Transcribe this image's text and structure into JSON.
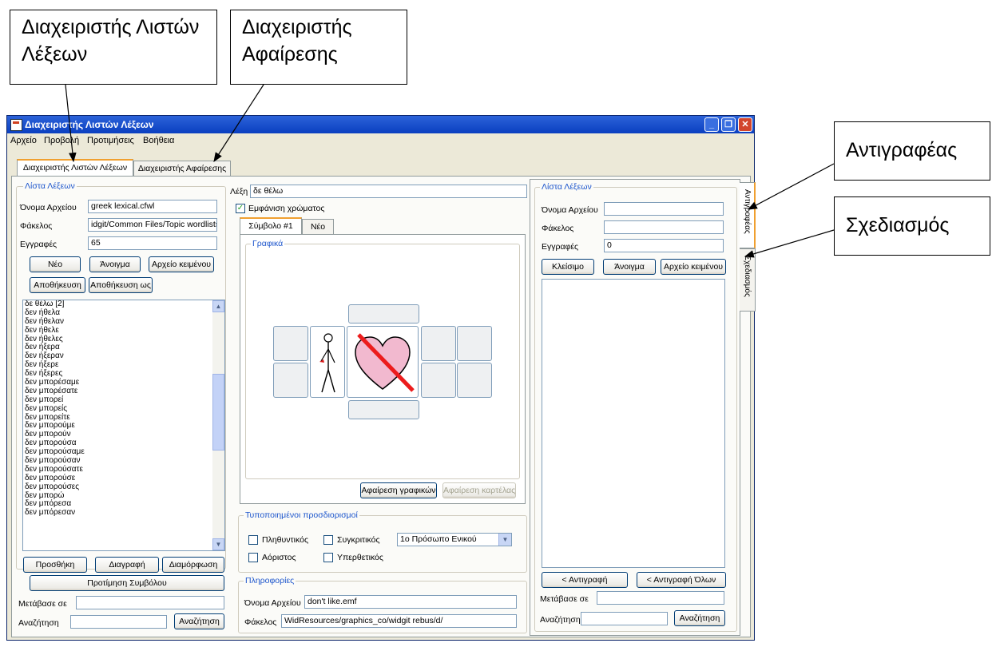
{
  "callouts": {
    "wordlist_manager": "Διαχειριστής Λιστών Λέξεων",
    "removal_manager": "Διαχειριστής Αφαίρεσης",
    "copier": "Αντιγραφέας",
    "design": "Σχεδιασμός"
  },
  "window": {
    "title": "Διαχειριστής Λιστών Λέξεων",
    "menu": [
      "Αρχείο",
      "Προβολή",
      "Προτιμήσεις",
      "Βοήθεια"
    ],
    "tabs": [
      "Διαχειριστής Λιστών Λέξεων",
      "Διαχειριστής Αφαίρεσης"
    ]
  },
  "left": {
    "group_label": "Λίστα Λέξεων",
    "filename_label": "Όνομα Αρχείου",
    "filename_value": "greek lexical.cfwl",
    "folder_label": "Φάκελος",
    "folder_value": "idgit/Common Files/Topic wordlists/",
    "entries_label": "Εγγραφές",
    "entries_value": "65",
    "buttons": {
      "new": "Νέο",
      "open": "Άνοιγμα",
      "textfile": "Αρχείο κειμένου",
      "save": "Αποθήκευση",
      "saveas": "Αποθήκευση ως"
    },
    "words": [
      "δε θέλω [2]",
      "δεν ήθελα",
      "δεν ήθελαν",
      "δεν ήθελε",
      "δεν ήθελες",
      "δεν ήξερα",
      "δεν ήξεραν",
      "δεν ήξερε",
      "δεν ήξερες",
      "δεν μπορέσαμε",
      "δεν μπορέσατε",
      "δεν μπορεί",
      "δεν μπορείς",
      "δεν μπορείτε",
      "δεν μπορούμε",
      "δεν μπορούν",
      "δεν μπορούσα",
      "δεν μπορούσαμε",
      "δεν μπορούσαν",
      "δεν μπορούσατε",
      "δεν μπορούσε",
      "δεν μπορούσες",
      "δεν μπορώ",
      "δεν μπόρεσα",
      "δεν μπόρεσαν"
    ],
    "add": "Προσθήκη",
    "delete": "Διαγραφή",
    "format": "Διαμόρφωση",
    "pref_symbol": "Προτίμηση Συμβόλου",
    "goto_label": "Μετάβασε σε",
    "search_label": "Αναζήτηση",
    "search_button": "Αναζήτηση"
  },
  "center": {
    "word_label": "Λέξη",
    "word_value": "δε θέλω",
    "show_colour": "Εμφάνιση χρώματος",
    "show_colour_checked": true,
    "tabs": [
      "Σύμβολο #1",
      "Νέο"
    ],
    "graphics_label": "Γραφικά",
    "remove_graphics": "Αφαίρεση γραφικών",
    "remove_tab": "Αφαίρεση καρτέλας",
    "modifiers_label": "Τυποποιημένοι προσδιορισμοί",
    "plural": "Πληθυντικός",
    "comparative": "Συγκριτικός",
    "indefinite": "Αόριστος",
    "superlative": "Υπερθετικός",
    "person_select": "1ο Πρόσωπο Ενικού",
    "info_label": "Πληροφορίες",
    "info_filename_label": "Όνομα Αρχείου",
    "info_filename": "don't like.emf",
    "info_folder_label": "Φάκελος",
    "info_folder": "WidResources/graphics_co/widgit rebus/d/"
  },
  "right": {
    "group_label": "Λίστα Λέξεων",
    "filename_label": "Όνομα Αρχείου",
    "filename_value": "",
    "folder_label": "Φάκελος",
    "folder_value": "",
    "entries_label": "Εγγραφές",
    "entries_value": "0",
    "close": "Κλείσιμο",
    "open": "Άνοιγμα",
    "textfile": "Αρχείο κειμένου",
    "copy": "< Αντιγραφή",
    "copy_all": "< Αντιγραφή Όλων",
    "goto_label": "Μετάβασε σε",
    "search_label": "Αναζήτηση",
    "search_button": "Αναζήτηση",
    "vtabs": [
      "Αντιγραφέας",
      "Σχεδιασμός"
    ]
  }
}
